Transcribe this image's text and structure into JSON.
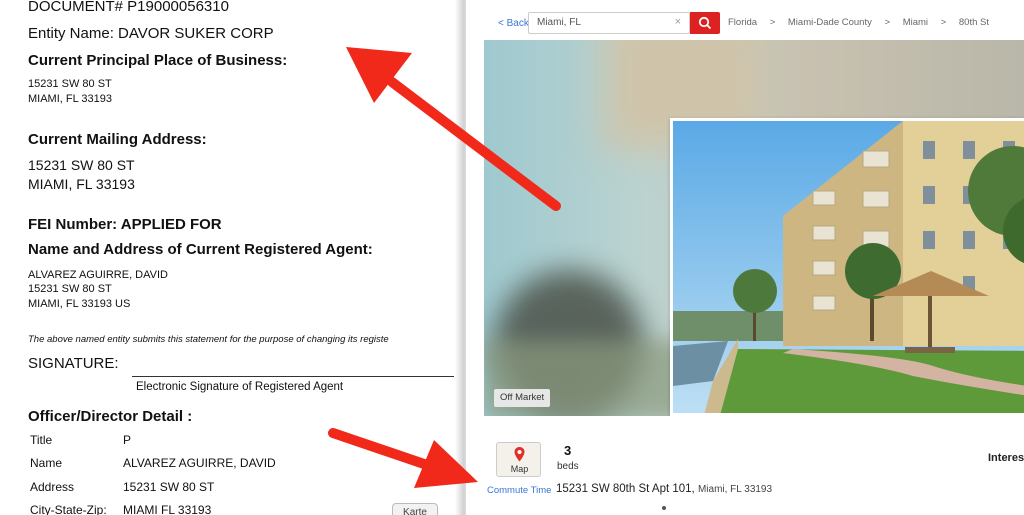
{
  "document": {
    "doc_number": "DOCUMENT# P19000056310",
    "entity_name": "Entity Name: DAVOR SUKER CORP",
    "principal_heading": "Current Principal  Place of Business:",
    "principal_line1": "15231 SW 80 ST",
    "principal_line2": "MIAMI,  FL  33193",
    "mailing_heading": "Current Mailing Address:",
    "mailing_line1": "15231 SW 80 ST",
    "mailing_line2": "MIAMI,  FL  33193",
    "fei": "FEI Number: APPLIED FOR",
    "agent_heading": "Name and Address of Current Registered Agent:",
    "agent_line1": "ALVAREZ AGUIRRE, DAVID",
    "agent_line2": "15231 SW 80 ST",
    "agent_line3": "MIAMI,  FL  33193  US",
    "statement": "The above named entity submits this statement for the purpose of changing its registe",
    "signature_label": "SIGNATURE:",
    "signature_caption": "Electronic Signature of Registered Agent",
    "officer_heading": "Officer/Director Detail :",
    "officer_rows": [
      {
        "key": "Title",
        "value": "P"
      },
      {
        "key": "Name",
        "value": "ALVAREZ AGUIRRE, DAVID"
      },
      {
        "key": "Address",
        "value": "15231 SW 80 ST"
      },
      {
        "key": "City-State-Zip:",
        "value": "MIAMI  FL  33193"
      }
    ],
    "karte_button": "Karte"
  },
  "listing": {
    "back_label": "< Back",
    "search_value": "Miami, FL",
    "search_clear": "×",
    "breadcrumbs": [
      "Florida",
      ">",
      "Miami-Dade County",
      ">",
      "Miami",
      ">",
      "80th St"
    ],
    "status_badge": "Off Market",
    "map_label": "Map",
    "commute_label": "Commute Time",
    "beds_count": "3",
    "beds_label": "beds",
    "street": "15231 SW 80th St Apt 101,",
    "city": "Miami, FL 33193",
    "interest_label": "Interes"
  },
  "colors": {
    "arrow": "#f0291b",
    "accent_blue": "#3a77d8",
    "search_red": "#d22222"
  },
  "icons": [
    "search-icon",
    "map-pin-icon",
    "close-icon"
  ]
}
